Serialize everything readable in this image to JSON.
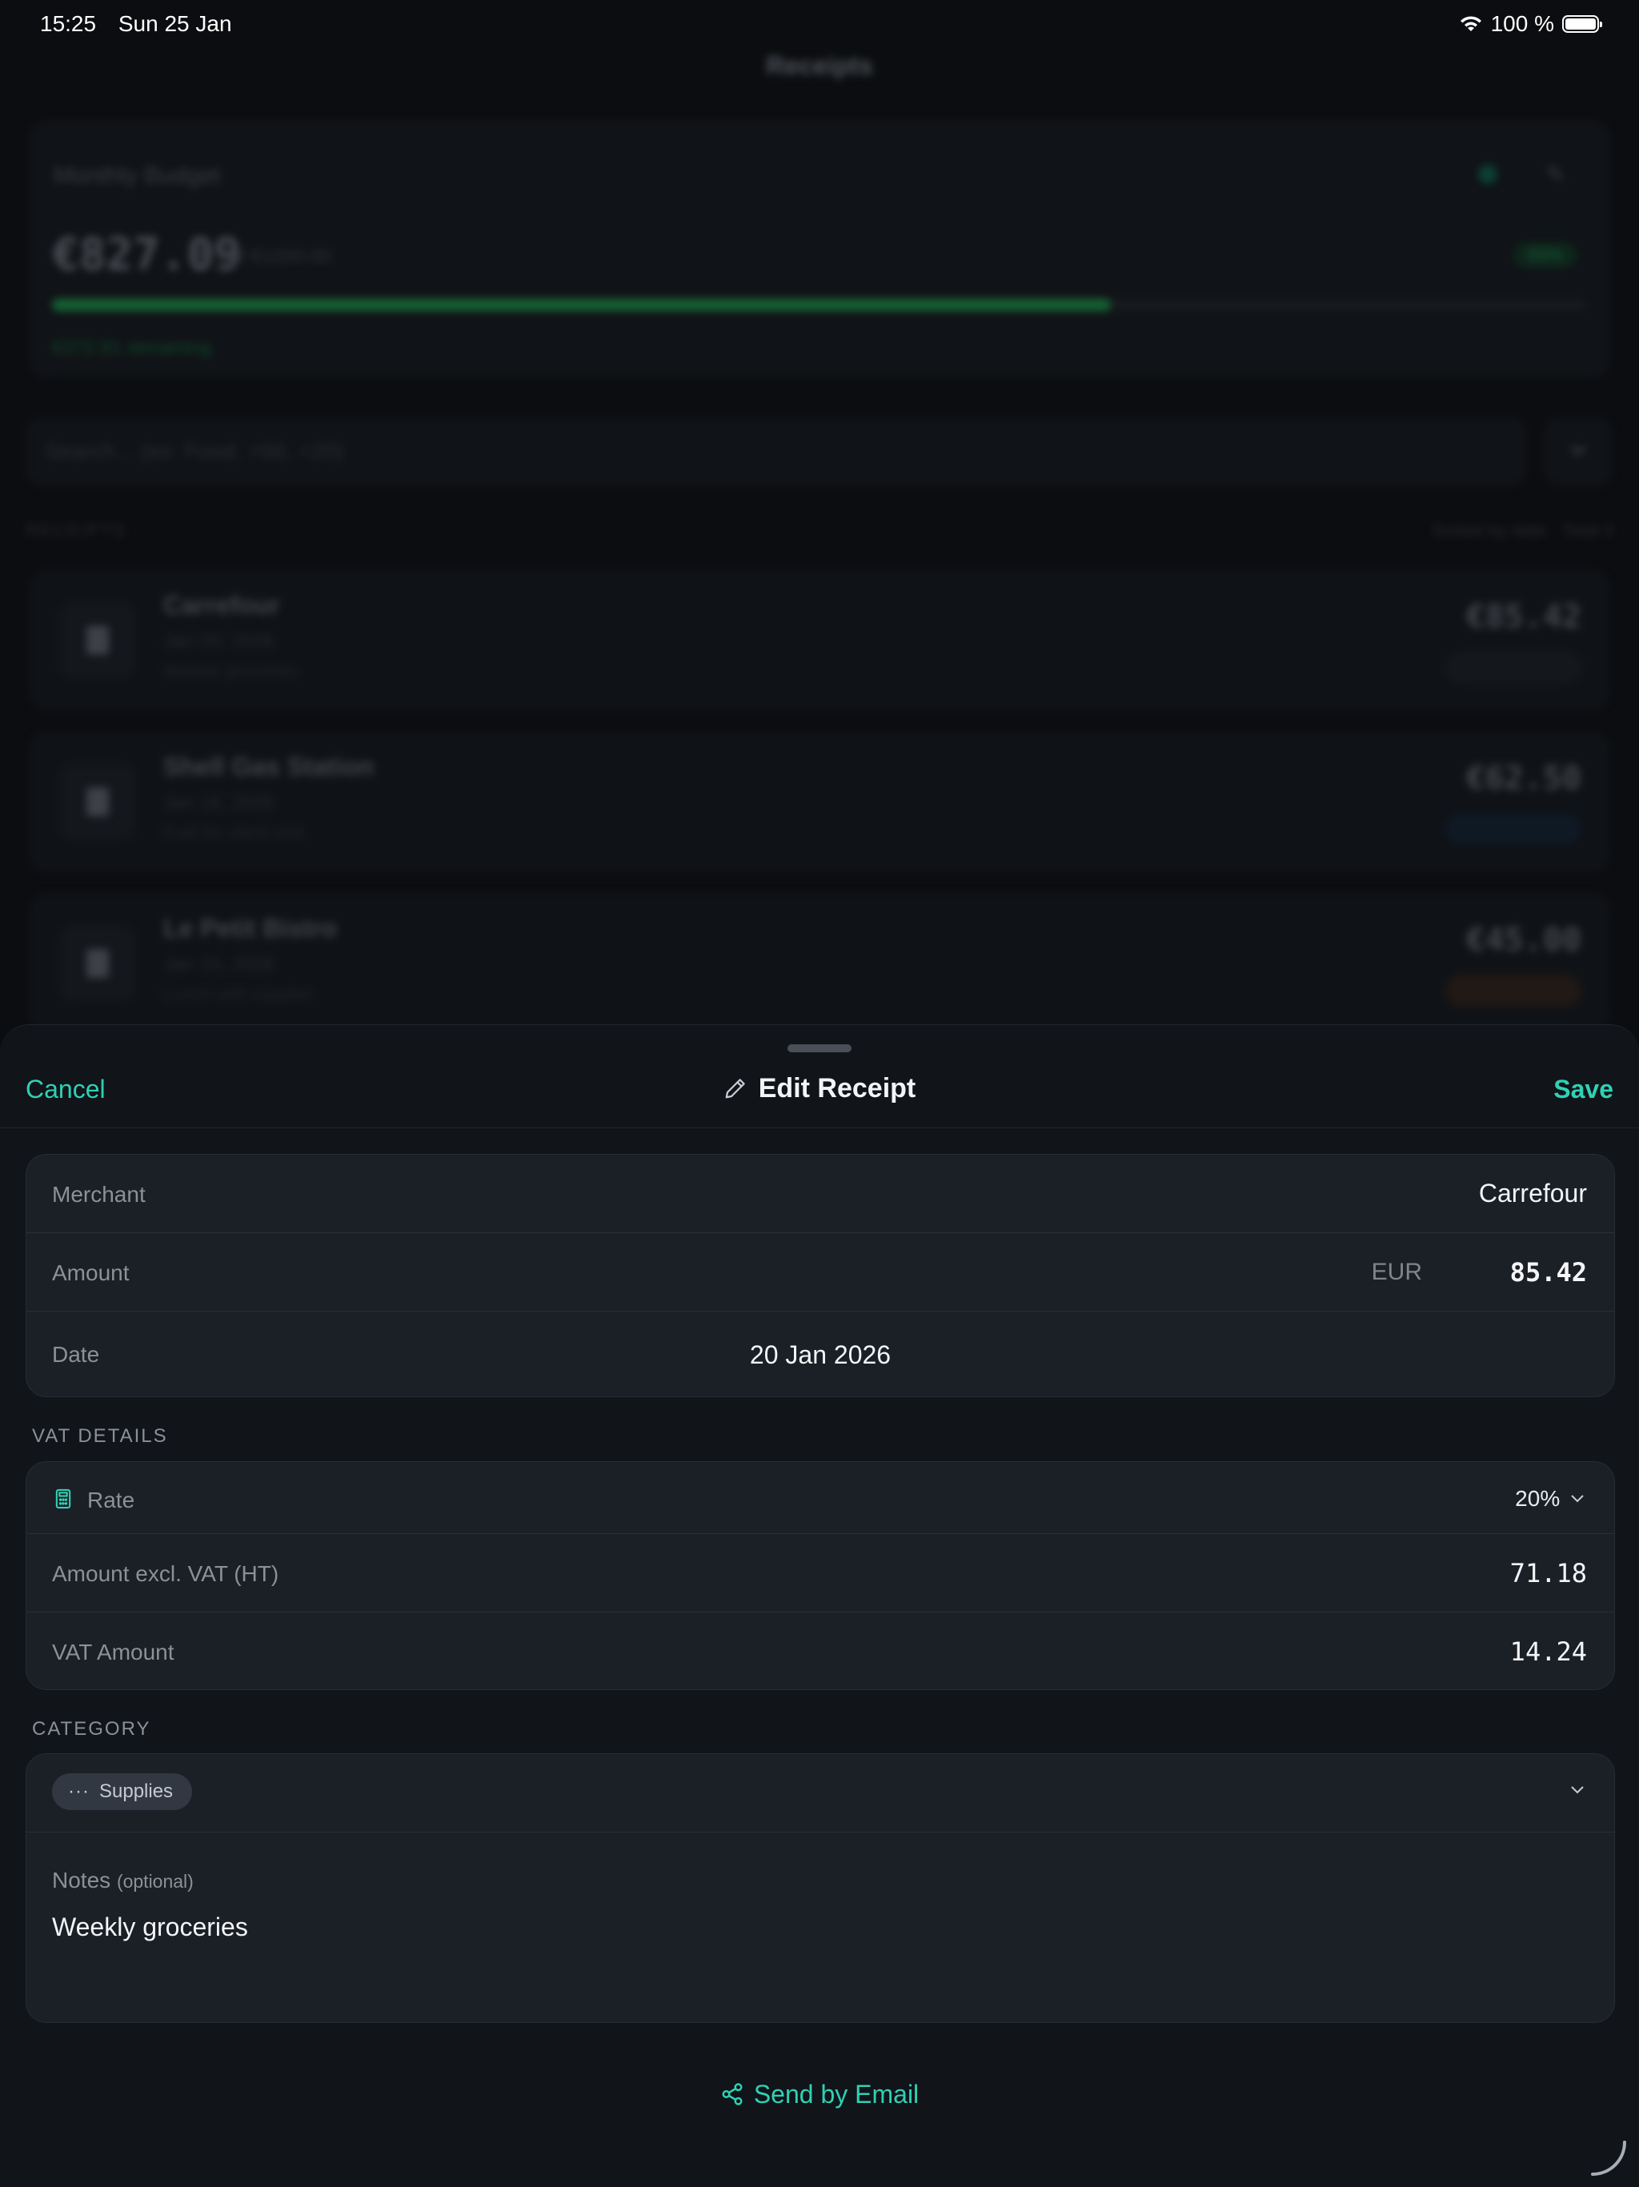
{
  "status": {
    "time": "15:25",
    "date": "Sun 25 Jan",
    "battery": "100 %"
  },
  "background": {
    "nav_title": "Receipts",
    "budget": {
      "label": "Monthly Budget",
      "amount": "€827.09",
      "of_total": "of €1200.00",
      "percent": "69%",
      "progress_fraction": 0.69,
      "remaining": "€372.91 remaining"
    },
    "search_placeholder": "Search... (ex: Food, >50, <20)",
    "section_label": "RECEIPTS",
    "section_meta": "Sorted by date · Total 3",
    "receipts": [
      {
        "merchant": "Carrefour",
        "date": "Jan 20, 2026",
        "note": "Weekly groceries",
        "amount": "€85.42"
      },
      {
        "merchant": "Shell Gas Station",
        "date": "Jan 18, 2026",
        "note": "Fuel for client visit",
        "amount": "€62.50"
      },
      {
        "merchant": "Le Petit Bistro",
        "date": "Jan 15, 2026",
        "note": "Lunch with supplier",
        "amount": "€45.00"
      }
    ]
  },
  "sheet": {
    "cancel": "Cancel",
    "title": "Edit Receipt",
    "save": "Save",
    "merchant_label": "Merchant",
    "merchant_value": "Carrefour",
    "amount_label": "Amount",
    "currency": "EUR",
    "amount_value": "85.42",
    "date_label": "Date",
    "date_value": "20 Jan 2026",
    "vat_section": "VAT DETAILS",
    "rate_label": "Rate",
    "rate_value": "20%",
    "excl_label": "Amount excl. VAT (HT)",
    "excl_value": "71.18",
    "vat_label": "VAT Amount",
    "vat_value": "14.24",
    "category_section": "CATEGORY",
    "category_value": "Supplies",
    "notes_label": "Notes",
    "notes_optional": "(optional)",
    "notes_value": "Weekly groceries",
    "email_button": "Send by Email"
  },
  "colors": {
    "accent": "#2fd1b4",
    "sheet_bg": "#111419",
    "group_bg": "#1b1f26"
  }
}
